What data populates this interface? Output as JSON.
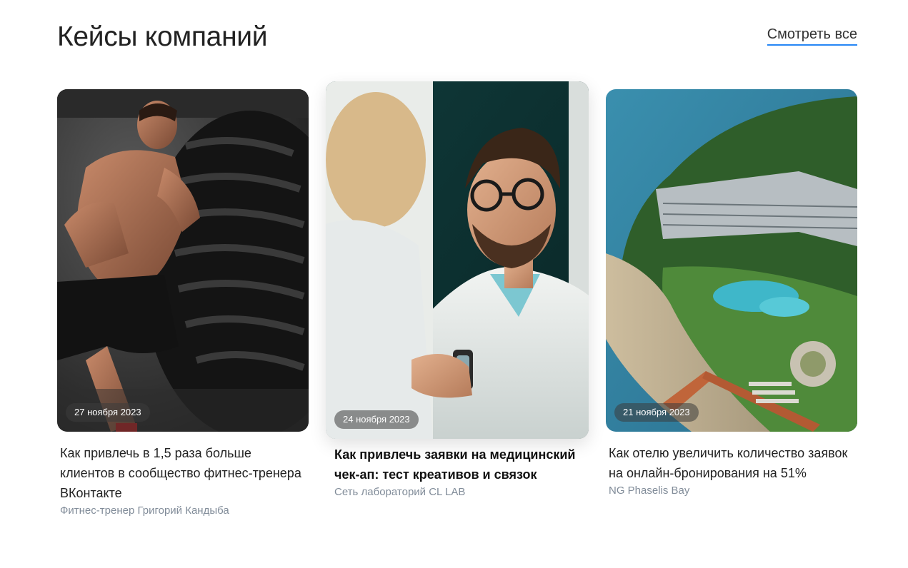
{
  "section": {
    "title": "Кейсы компаний",
    "see_all": "Смотреть все"
  },
  "cards": [
    {
      "date": "27 ноября 2023",
      "title": "Как привлечь в 1,5 раза больше клиентов в сообщество фитнес-тренера ВКонтакте",
      "subtitle": "Фитнес-тренер Григорий Кандыба",
      "image": "fitness-tire-photo"
    },
    {
      "date": "24 ноября 2023",
      "title": "Как привлечь заявки на медицинский чек-ап: тест креативов и связок",
      "subtitle": "Сеть лабораторий CL LAB",
      "image": "doctor-consultation-photo"
    },
    {
      "date": "21 ноября 2023",
      "title": "Как отелю увеличить количество заявок на онлайн-бронирования на 51%",
      "subtitle": "NG Phaselis Bay",
      "image": "resort-aerial-photo"
    }
  ]
}
